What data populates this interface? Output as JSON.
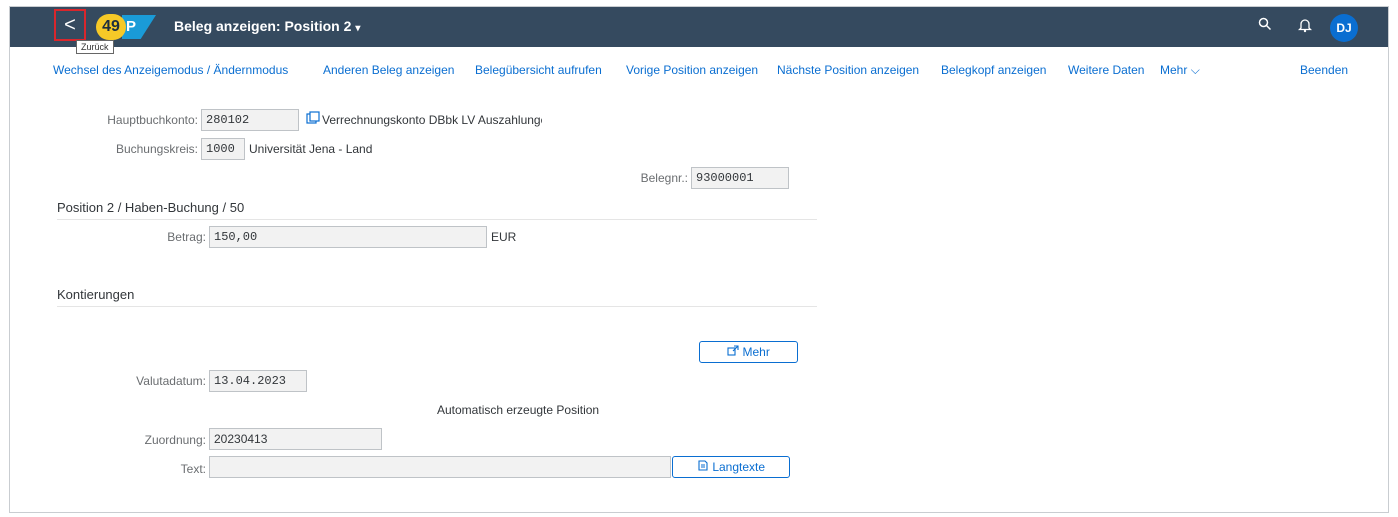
{
  "shell": {
    "back_glyph": "<",
    "step_badge": "49",
    "logo_text": "P",
    "title": "Beleg anzeigen: Position 2",
    "title_caret": "▾",
    "back_tooltip": "Zurück",
    "avatar_initials": "DJ",
    "search_icon": "search-icon",
    "bell_icon": "bell-icon"
  },
  "toolbar": {
    "items": [
      "Wechsel des Anzeigemodus / Ändernmodus",
      "Anderen Beleg anzeigen",
      "Belegübersicht aufrufen",
      "Vorige Position anzeigen",
      "Nächste Position anzeigen",
      "Belegkopf anzeigen",
      "Weitere Daten",
      "Mehr"
    ],
    "more_chevron": "⌵",
    "exit": "Beenden"
  },
  "header": {
    "gl_account_label": "Hauptbuchkonto:",
    "gl_account_value": "280102",
    "gl_account_text": "Verrechnungskonto DBbk LV Auszahlungen",
    "company_code_label": "Buchungskreis:",
    "company_code_value": "1000",
    "company_code_text": "Universität Jena - Land",
    "doc_no_label": "Belegnr.:",
    "doc_no_value": "93000001"
  },
  "position": {
    "section_title": "Position 2 / Haben-Buchung / 50",
    "amount_label": "Betrag:",
    "amount_value": "150,00",
    "currency": "EUR"
  },
  "assignments": {
    "section_title": "Kontierungen",
    "more_button": "Mehr",
    "value_date_label": "Valutadatum:",
    "value_date_value": "13.04.2023",
    "auto_generated": "Automatisch erzeugte Position",
    "assignment_label": "Zuordnung:",
    "assignment_value": "20230413",
    "text_label": "Text:",
    "text_value": "",
    "long_texts_button": "Langtexte"
  }
}
